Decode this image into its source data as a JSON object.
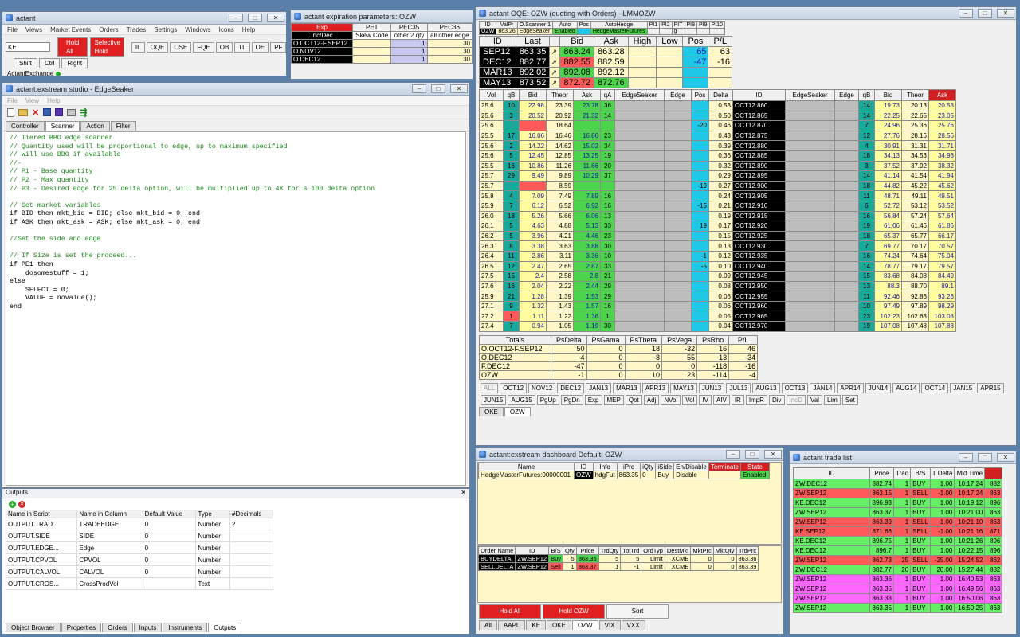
{
  "main": {
    "title": "actant",
    "menu": [
      "File",
      "Views",
      "Market Events",
      "Orders",
      "Trades",
      "Settings",
      "Windows",
      "Icons",
      "Help"
    ],
    "symbol_value": "KE",
    "hold_all": "Hold All",
    "selective_hold": "Selective Hold",
    "buttons": [
      "IL",
      "OQE",
      "OSE",
      "FQE",
      "OB",
      "TL",
      "OE",
      "PF"
    ],
    "mod_buttons": [
      "Shift",
      "Ctrl",
      "Right"
    ],
    "status": "ActantExchange"
  },
  "expiry": {
    "title": "actant expiration parameters: OZW",
    "headers": [
      "Exp",
      "PET",
      "PEC35",
      "PEC36"
    ],
    "subheaders": [
      "Inc/Dec",
      "Skew Code",
      "other 2 qty",
      "all other edge"
    ],
    "rows": [
      {
        "exp": "O.OCT12-F.SEP12",
        "pec35": "1",
        "pec36": "30"
      },
      {
        "exp": "O.NOV12",
        "pec35": "1",
        "pec36": "30"
      },
      {
        "exp": "O.DEC12",
        "pec35": "1",
        "pec36": "30"
      }
    ]
  },
  "studio": {
    "title": "actant:exstream studio - EdgeSeaker",
    "menu": [
      "File",
      "View",
      "Help"
    ],
    "tabs": [
      "Controller",
      "Scanner",
      "Action",
      "Filter"
    ],
    "active_tab": "Scanner",
    "code_lines": [
      {
        "t": "c",
        "s": "// Tiered BBO edge scanner"
      },
      {
        "t": "c",
        "s": "// Quantity used will be proportional to edge, up to maximum specified"
      },
      {
        "t": "c",
        "s": "// Will use BBO if available"
      },
      {
        "t": "c",
        "s": "//-"
      },
      {
        "t": "c",
        "s": "// P1 - Base quantity"
      },
      {
        "t": "c",
        "s": "// P2 - Max quantity"
      },
      {
        "t": "c",
        "s": "// P3 - Desired edge for 25 delta option, will be multiplied up to 4X for a 100 delta option"
      },
      {
        "t": "p",
        "s": ""
      },
      {
        "t": "c",
        "s": "// Set market variables"
      },
      {
        "t": "p",
        "s": "if BID then mkt_bid = BID; else mkt_bid = 0; end"
      },
      {
        "t": "p",
        "s": "if ASK then mkt_ask = ASK; else mkt_ask = 0; end"
      },
      {
        "t": "p",
        "s": ""
      },
      {
        "t": "c",
        "s": "//Set the side and edge"
      },
      {
        "t": "p",
        "s": ""
      },
      {
        "t": "c",
        "s": "// If Size is set the proceed..."
      },
      {
        "t": "p",
        "s": "if PE1 then"
      },
      {
        "t": "p",
        "s": "    dosomestuff = 1;"
      },
      {
        "t": "p",
        "s": "else"
      },
      {
        "t": "p",
        "s": "    SELECT = 0;"
      },
      {
        "t": "p",
        "s": "    VALUE = novalue();"
      },
      {
        "t": "p",
        "s": "end"
      }
    ]
  },
  "outputs": {
    "title": "Outputs",
    "headers": [
      "Name in Script",
      "Name in Column",
      "Default Value",
      "Type",
      "#Decimals"
    ],
    "rows": [
      [
        "OUTPUT.TRAD...",
        "TRADEEDGE",
        "0",
        "Number",
        "2"
      ],
      [
        "OUTPUT.SIDE",
        "SIDE",
        "0",
        "Number",
        ""
      ],
      [
        "OUTPUT.EDGE...",
        "Edge",
        "0",
        "Number",
        ""
      ],
      [
        "OUTPUT.CPVOL",
        "CPVOL",
        "0",
        "Number",
        ""
      ],
      [
        "OUTPUT.CALVOL",
        "CALVOL",
        "0",
        "Number",
        ""
      ],
      [
        "OUTPUT.CROS...",
        "CrossProdVol",
        "",
        "Text",
        ""
      ]
    ],
    "bottom_tabs": [
      "Object Browser",
      "Properties",
      "Orders",
      "Inputs",
      "Instruments",
      "Outputs"
    ]
  },
  "oqe": {
    "title": "actant OQE: OZW (quoting with Orders) - LMMOZW",
    "top_headers": [
      "ID",
      "ValPr",
      "O.Scanner 1",
      "Auto",
      "Pos",
      "AutoHedge",
      "PI1",
      "PI2",
      "PIT",
      "PI8",
      "PI9",
      "PI10"
    ],
    "top_values": [
      "OZW",
      "863.26",
      "EdgeSeaker",
      "Enabled",
      "",
      "HedgeMasterFutures",
      "",
      "",
      "g",
      "",
      "",
      ""
    ],
    "fut_headers": [
      "ID",
      "Last",
      "",
      "Bid",
      "Ask",
      "High",
      "Low",
      "Pos",
      "P/L"
    ],
    "futures": [
      {
        "id": "SEP12",
        "last": "863.35",
        "bid": "863.24",
        "ask": "863.28",
        "pos": "65",
        "pl": "63",
        "bidc": "grn",
        "askc": "lyel"
      },
      {
        "id": "DEC12",
        "last": "882.77",
        "bid": "882.55",
        "ask": "882.59",
        "pos": "-47",
        "pl": "-16",
        "bidc": "red",
        "askc": "lyel"
      },
      {
        "id": "MAR13",
        "last": "892.02",
        "bid": "892.08",
        "ask": "892.12",
        "pos": "",
        "pl": "",
        "bidc": "grn",
        "askc": "lyel"
      },
      {
        "id": "MAY13",
        "last": "873.52",
        "bid": "872.72",
        "ask": "872.76",
        "pos": "",
        "pl": "",
        "bidc": "red",
        "askc": "grn"
      }
    ],
    "chain_headers": [
      "Vol",
      "qB",
      "Bid",
      "Theor",
      "Ask",
      "qA",
      "EdgeSeaker",
      "Edge",
      "Pos",
      "Delta",
      "ID",
      "EdgeSeaker",
      "Edge",
      "qB",
      "Bid",
      "Theor",
      "Ask"
    ],
    "chain": [
      [
        "25.6",
        "10",
        "22.98",
        "23.39",
        "23.78",
        "36",
        "",
        "",
        "",
        "0.53",
        "OCT12.860",
        "",
        "",
        "14",
        "19.73",
        "20.13",
        "20.53"
      ],
      [
        "25.6",
        "3",
        "20.52",
        "20.92",
        "21.32",
        "14",
        "",
        "",
        "",
        "0.50",
        "OCT12.865",
        "",
        "",
        "14",
        "22.25",
        "22.65",
        "23.05"
      ],
      [
        "25.6",
        "",
        "",
        "18.64",
        "",
        "",
        "",
        "",
        "-20",
        "0.46",
        "OCT12.870",
        "",
        "",
        "7",
        "24.96",
        "25.36",
        "25.76"
      ],
      [
        "25.5",
        "17",
        "16.06",
        "16.46",
        "16.86",
        "23",
        "",
        "",
        "",
        "0.43",
        "OCT12.875",
        "",
        "",
        "12",
        "27.76",
        "28.16",
        "28.56"
      ],
      [
        "25.6",
        "2",
        "14.22",
        "14.62",
        "15.02",
        "34",
        "",
        "",
        "",
        "0.39",
        "OCT12.880",
        "",
        "",
        "4",
        "30.91",
        "31.31",
        "31.71"
      ],
      [
        "25.6",
        "5",
        "12.45",
        "12.85",
        "13.25",
        "19",
        "",
        "",
        "",
        "0.36",
        "OCT12.885",
        "",
        "",
        "18",
        "34.13",
        "34.53",
        "34.93"
      ],
      [
        "25.5",
        "16",
        "10.86",
        "11.26",
        "11.66",
        "20",
        "",
        "",
        "",
        "0.32",
        "OCT12.890",
        "",
        "",
        "3",
        "37.52",
        "37.92",
        "38.32"
      ],
      [
        "25.7",
        "29",
        "9.49",
        "9.89",
        "10.29",
        "37",
        "",
        "",
        "",
        "0.29",
        "OCT12.895",
        "",
        "",
        "14",
        "41.14",
        "41.54",
        "41.94"
      ],
      [
        "25.7",
        "",
        "",
        "8.59",
        "",
        "",
        "",
        "",
        "-19",
        "0.27",
        "OCT12.900",
        "",
        "",
        "18",
        "44.82",
        "45.22",
        "45.62"
      ],
      [
        "25.8",
        "4",
        "7.09",
        "7.49",
        "7.89",
        "16",
        "",
        "",
        "",
        "0.24",
        "OCT12.905",
        "",
        "",
        "11",
        "48.71",
        "49.11",
        "49.51"
      ],
      [
        "25.9",
        "7",
        "6.12",
        "6.52",
        "6.92",
        "16",
        "",
        "",
        "-15",
        "0.21",
        "OCT12.910",
        "",
        "",
        "6",
        "52.72",
        "53.12",
        "53.52"
      ],
      [
        "26.0",
        "18",
        "5.26",
        "5.66",
        "6.06",
        "13",
        "",
        "",
        "",
        "0.19",
        "OCT12.915",
        "",
        "",
        "16",
        "56.84",
        "57.24",
        "57.64"
      ],
      [
        "26.1",
        "5",
        "4.63",
        "4.88",
        "5.13",
        "33",
        "",
        "",
        "19",
        "0.17",
        "OCT12.920",
        "",
        "",
        "19",
        "61.06",
        "61.46",
        "61.86"
      ],
      [
        "26.2",
        "5",
        "3.96",
        "4.21",
        "4.46",
        "23",
        "",
        "",
        "",
        "0.15",
        "OCT12.925",
        "",
        "",
        "18",
        "65.37",
        "65.77",
        "66.17"
      ],
      [
        "26.3",
        "8",
        "3.38",
        "3.63",
        "3.88",
        "30",
        "",
        "",
        "",
        "0.13",
        "OCT12.930",
        "",
        "",
        "7",
        "69.77",
        "70.17",
        "70.57"
      ],
      [
        "26.4",
        "11",
        "2.86",
        "3.11",
        "3.36",
        "10",
        "",
        "",
        "-1",
        "0.12",
        "OCT12.935",
        "",
        "",
        "16",
        "74.24",
        "74.64",
        "75.04"
      ],
      [
        "26.5",
        "12",
        "2.47",
        "2.65",
        "2.87",
        "33",
        "",
        "",
        "-5",
        "0.10",
        "OCT12.940",
        "",
        "",
        "14",
        "78.77",
        "79.17",
        "79.57"
      ],
      [
        "27.5",
        "15",
        "2.4",
        "2.58",
        "2.8",
        "21",
        "",
        "",
        "",
        "0.09",
        "OCT12.945",
        "",
        "",
        "15",
        "83.68",
        "84.08",
        "84.49"
      ],
      [
        "27.6",
        "16",
        "2.04",
        "2.22",
        "2.44",
        "29",
        "",
        "",
        "",
        "0.08",
        "OCT12.950",
        "",
        "",
        "13",
        "88.3",
        "88.70",
        "89.1"
      ],
      [
        "25.9",
        "21",
        "1.28",
        "1.39",
        "1.53",
        "29",
        "",
        "",
        "",
        "0.06",
        "OCT12.955",
        "",
        "",
        "11",
        "92.46",
        "92.86",
        "93.26"
      ],
      [
        "27.1",
        "9",
        "1.32",
        "1.43",
        "1.57",
        "16",
        "",
        "",
        "",
        "0.06",
        "OCT12.960",
        "",
        "",
        "10",
        "97.49",
        "97.89",
        "98.29"
      ],
      [
        "27.2",
        "1",
        "1.11",
        "1.22",
        "1.36",
        "1",
        "",
        "",
        "",
        "0.05",
        "OCT12.965",
        "",
        "",
        "23",
        "102.23",
        "102.63",
        "103.08"
      ],
      [
        "27.4",
        "7",
        "0.94",
        "1.05",
        "1.19",
        "30",
        "",
        "",
        "",
        "0.04",
        "OCT12.970",
        "",
        "",
        "19",
        "107.08",
        "107.48",
        "107.88"
      ]
    ],
    "totals_headers": [
      "Totals",
      "PsDelta",
      "PsGama",
      "PsTheta",
      "PsVega",
      "PsRho",
      "P/L"
    ],
    "totals": [
      [
        "O.OCT12-F.SEP12",
        "50",
        "0",
        "18",
        "-32",
        "16",
        "46"
      ],
      [
        "O.DEC12",
        "-4",
        "0",
        "-8",
        "55",
        "-13",
        "-34"
      ],
      [
        "F.DEC12",
        "-47",
        "0",
        "0",
        "0",
        "-118",
        "-16"
      ],
      [
        "OZW",
        "-1",
        "0",
        "10",
        "23",
        "-114",
        "-4"
      ]
    ],
    "month_tabs_1": [
      "ALL",
      "OCT12",
      "NOV12",
      "DEC12",
      "JAN13",
      "MAR13",
      "APR13",
      "MAY13",
      "JUN13",
      "JUL13",
      "AUG13",
      "OCT13",
      "JAN14",
      "APR14",
      "JUN14",
      "AUG14",
      "OCT14",
      "JAN15",
      "APR15"
    ],
    "month_tabs_2": [
      "JUN15",
      "AUG15",
      "PgUp",
      "PgDn",
      "Exp",
      "MEP",
      "Qot",
      "Adj",
      "NVol",
      "Vol",
      "IV",
      "AIV",
      "IR",
      "ImpR",
      "Div",
      "IncD",
      "Val",
      "Lim",
      "Set"
    ],
    "bottom_tabs": [
      "OKE",
      "OZW"
    ]
  },
  "dash": {
    "title": "actant:exstream dashboard Default: OZW",
    "headers": [
      "Name",
      "ID",
      "Info",
      "iPrc",
      "iQty",
      "iSide",
      "En/Disable",
      "Terminate",
      "State"
    ],
    "row": [
      "HedgeMasterFutures:00000001",
      "OZW",
      "hdgFut",
      "863.35",
      "0",
      "Buy",
      "Disable",
      "",
      "Enabled"
    ],
    "order_headers": [
      "Order Name",
      "ID",
      "B/S",
      "Qty",
      "Price",
      "TrdQty",
      "TotTrd",
      "OrdTyp",
      "DestMkt",
      "MktPrc",
      "MktQty",
      "TrdPrc"
    ],
    "orders": [
      [
        "BUYDELTA",
        "ZW.SEP12",
        "Buy",
        "5",
        "863.35",
        "5",
        "5",
        "Limit",
        "XCME",
        "0",
        "0",
        "863.36"
      ],
      [
        "SELLDELTA",
        "ZW.SEP12",
        "Sell",
        "1",
        "863.37",
        "1",
        "-1",
        "Limit",
        "XCME",
        "0",
        "0",
        "863.39"
      ]
    ],
    "hold_all": "Hold All",
    "hold_ozw": "Hold OZW",
    "sort": "Sort",
    "bottom_tabs": [
      "All",
      "AAPL",
      "KE",
      "OKE",
      "OZW",
      "VIX",
      "VXX"
    ]
  },
  "trades": {
    "title": "actant trade list",
    "headers": [
      "ID",
      "Price",
      "Trad",
      "B/S",
      "T Delta",
      "Mkt Time",
      "Vol"
    ],
    "rows": [
      {
        "c": "lgn",
        "v": [
          "ZW.DEC12",
          "882.74",
          "1",
          "BUY",
          "1.00",
          "10:17:24",
          "882"
        ]
      },
      {
        "c": "red",
        "v": [
          "ZW.SEP12",
          "863.15",
          "1",
          "SELL",
          "-1.00",
          "10:17:24",
          "863"
        ]
      },
      {
        "c": "lgn",
        "v": [
          "KE.DEC12",
          "896.93",
          "1",
          "BUY",
          "1.00",
          "10:19:12",
          "896"
        ]
      },
      {
        "c": "lgn",
        "v": [
          "ZW.SEP12",
          "863.37",
          "1",
          "BUY",
          "1.00",
          "10:21:00",
          "863"
        ]
      },
      {
        "c": "red",
        "v": [
          "ZW.SEP12",
          "863.39",
          "1",
          "SELL",
          "-1.00",
          "10:21:10",
          "863"
        ]
      },
      {
        "c": "red",
        "v": [
          "KE.SEP12",
          "871.66",
          "1",
          "SELL",
          "-1.00",
          "10:21:16",
          "871"
        ]
      },
      {
        "c": "lgn",
        "v": [
          "KE.DEC12",
          "896.75",
          "1",
          "BUY",
          "1.00",
          "10:21:26",
          "896"
        ]
      },
      {
        "c": "lgn",
        "v": [
          "KE.DEC12",
          "896.7",
          "1",
          "BUY",
          "1.00",
          "10:22:15",
          "896"
        ]
      },
      {
        "c": "red",
        "v": [
          "ZW.SEP12",
          "862.73",
          "25",
          "SELL",
          "-25.00",
          "15:24:52",
          "862"
        ]
      },
      {
        "c": "lgn",
        "v": [
          "ZW.DEC12",
          "882.77",
          "20",
          "BUY",
          "20.00",
          "15:27:44",
          "882"
        ]
      },
      {
        "c": "mag",
        "v": [
          "ZW.SEP12",
          "863.36",
          "1",
          "BUY",
          "1.00",
          "16:40:53",
          "863"
        ]
      },
      {
        "c": "mag",
        "v": [
          "ZW.SEP12",
          "863.35",
          "1",
          "BUY",
          "1.00",
          "16:49:56",
          "863"
        ]
      },
      {
        "c": "mag",
        "v": [
          "ZW.SEP12",
          "863.33",
          "1",
          "BUY",
          "1.00",
          "16:50:06",
          "863"
        ]
      },
      {
        "c": "lgn",
        "v": [
          "ZW.SEP12",
          "863.35",
          "1",
          "BUY",
          "1.00",
          "16:50:25",
          "863"
        ]
      }
    ]
  }
}
